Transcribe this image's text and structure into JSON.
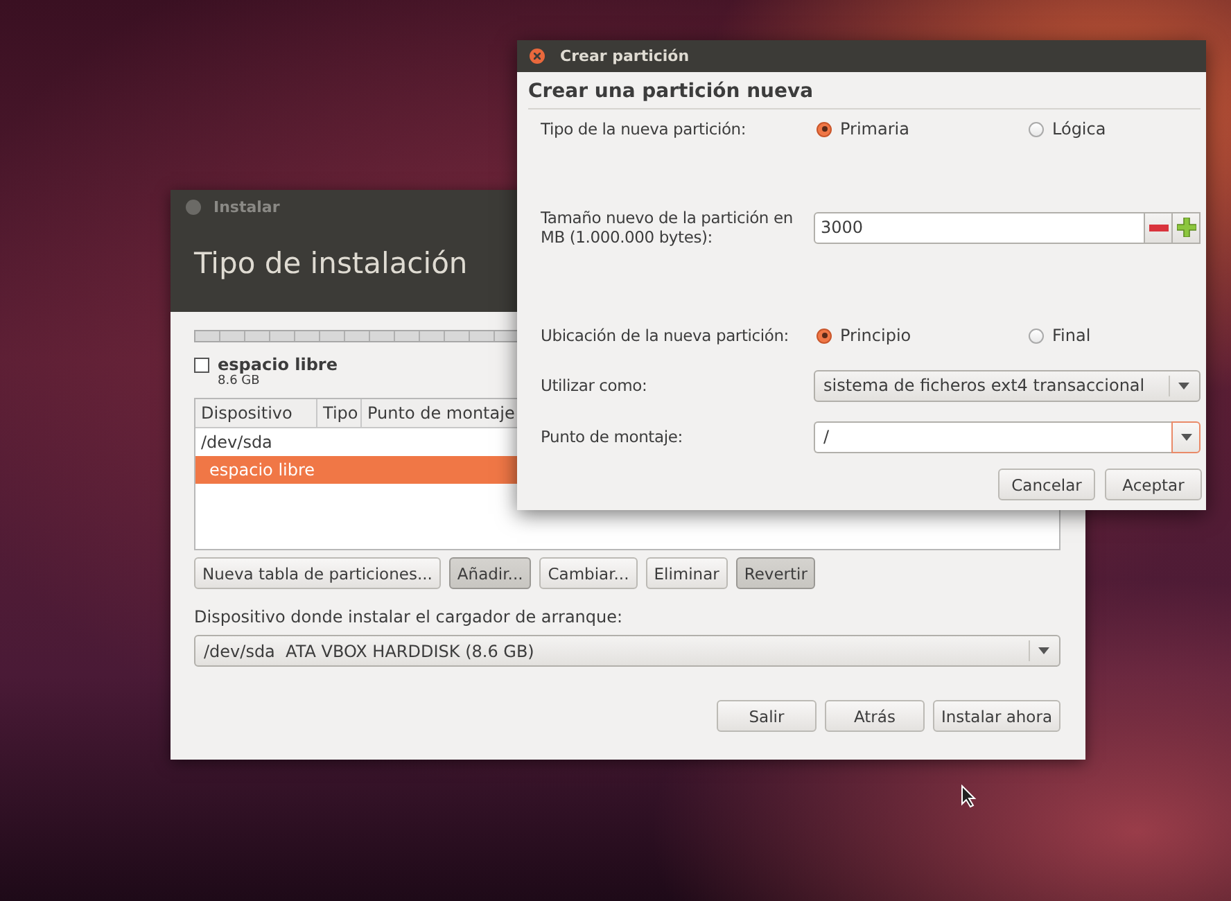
{
  "installer": {
    "title": "Instalar",
    "heading": "Tipo de instalación",
    "free_space": {
      "label": "espacio libre",
      "size": "8.6 GB",
      "checked": false
    },
    "table": {
      "columns": [
        "Dispositivo",
        "Tipo",
        "Punto de montaje"
      ],
      "rows": [
        {
          "device": "/dev/sda",
          "selected": false
        },
        {
          "device": "espacio libre",
          "selected": true
        }
      ]
    },
    "partition_buttons": [
      {
        "label": "Nueva tabla de particiones...",
        "pressed": false
      },
      {
        "label": "Añadir...",
        "pressed": true
      },
      {
        "label": "Cambiar...",
        "pressed": false
      },
      {
        "label": "Eliminar",
        "pressed": false
      },
      {
        "label": "Revertir",
        "pressed": true
      }
    ],
    "bootloader_label": "Dispositivo donde instalar el cargador de arranque:",
    "bootloader_device": "/dev/sda  ATA VBOX HARDDISK (8.6 GB)",
    "buttons": [
      "Salir",
      "Atrás",
      "Instalar ahora"
    ]
  },
  "dialog": {
    "title": "Crear partición",
    "heading": "Crear una partición nueva",
    "type": {
      "label": "Tipo de la nueva partición:",
      "options": [
        {
          "label": "Primaria",
          "selected": true
        },
        {
          "label": "Lógica",
          "selected": false
        }
      ]
    },
    "size": {
      "label": "Tamaño nuevo de la partición en MB (1.000.000 bytes):",
      "value": "3000"
    },
    "location": {
      "label": "Ubicación de la nueva partición:",
      "options": [
        {
          "label": "Principio",
          "selected": true
        },
        {
          "label": "Final",
          "selected": false
        }
      ]
    },
    "use_as": {
      "label": "Utilizar como:",
      "value": "sistema de ficheros ext4 transaccional"
    },
    "mount_point": {
      "label": "Punto de montaje:",
      "value": "/"
    },
    "buttons": [
      "Cancelar",
      "Aceptar"
    ]
  }
}
